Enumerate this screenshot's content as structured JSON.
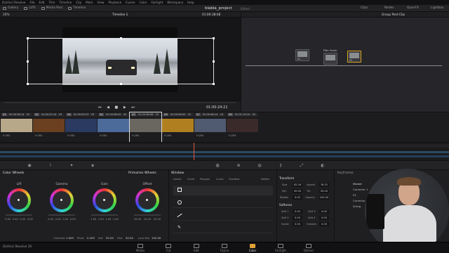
{
  "menubar": {
    "items": [
      "DaVinci Resolve",
      "File",
      "Edit",
      "Trim",
      "Timeline",
      "Clip",
      "Mark",
      "View",
      "Playback",
      "Fusion",
      "Color",
      "Fairlight",
      "Workspace",
      "Help"
    ]
  },
  "toolbar": {
    "left": [
      "Gallery",
      "LUTs",
      "Media Pool",
      "Timeline"
    ],
    "project_title": "blabla_project",
    "project_status": "Edited",
    "right": [
      "Clips",
      "Nodes",
      "OpenFX",
      "Lightbox"
    ]
  },
  "viewer": {
    "zoom": "26%",
    "timeline_name": "Timeline 1",
    "timecode_top": "01:00:38:08",
    "timecode_bottom": "01:00:24:21"
  },
  "nodes": {
    "panel_title": "Group Post-Clip",
    "node1_label": "01",
    "node2_label": "02",
    "film_grain_label": "Film Grain"
  },
  "clips": [
    {
      "num": "01",
      "tc": "01:00:36:14",
      "track": "V2",
      "codec": "H.264",
      "color": "#b7a88a"
    },
    {
      "num": "02",
      "tc": "01:00:22:14",
      "track": "V3",
      "codec": "H.264",
      "color": "#6a4020"
    },
    {
      "num": "03",
      "tc": "01:00:09:22",
      "track": "V3",
      "codec": "H.264",
      "color": "#2a3a60"
    },
    {
      "num": "04",
      "tc": "01:00:08:02",
      "track": "V2",
      "codec": "H.264",
      "color": "#4c6a9a"
    },
    {
      "num": "05",
      "tc": "01:00:38:08",
      "track": "V3",
      "codec": "H.264",
      "color": "#6a6660"
    },
    {
      "num": "06",
      "tc": "01:00:06:02",
      "track": "V2",
      "codec": "H.264",
      "color": "#b08020"
    },
    {
      "num": "07",
      "tc": "01:00:46:14",
      "track": "V3",
      "codec": "H.264",
      "color": "#505a70"
    },
    {
      "num": "08",
      "tc": "01:01:15:10",
      "track": "V2",
      "codec": "H.264",
      "color": "#3a2a2a"
    }
  ],
  "color_wheels": {
    "title": "Color Wheels",
    "mode": "Primaries Wheels",
    "wheels": [
      {
        "name": "Lift",
        "vals": [
          "0.00",
          "0.00",
          "0.00",
          "0.00"
        ]
      },
      {
        "name": "Gamma",
        "vals": [
          "0.00",
          "0.00",
          "0.00",
          "0.00"
        ]
      },
      {
        "name": "Gain",
        "vals": [
          "1.00",
          "1.00",
          "1.00",
          "1.00"
        ]
      },
      {
        "name": "Offset",
        "vals": [
          "25.00",
          "25.00",
          "25.00"
        ]
      }
    ],
    "footer": {
      "contrast_label": "Contrast",
      "contrast_val": "1.000",
      "pivot_label": "Pivot",
      "pivot_val": "0.435",
      "sat_label": "Sat",
      "sat_val": "50.00",
      "hue_label": "Hue",
      "hue_val": "50.00",
      "lum_mix_label": "Lum Mix",
      "lum_mix_val": "100.00"
    }
  },
  "window": {
    "title": "Window",
    "tools": [
      "Linear",
      "Circle",
      "Polygon",
      "Curve",
      "Gradient",
      "Delete"
    ]
  },
  "transform": {
    "title": "Transform",
    "size_label": "Size",
    "size_val": "62.26",
    "aspect_label": "Aspect",
    "aspect_val": "78.31",
    "pan_label": "Pan",
    "pan_val": "50.00",
    "tilt_label": "Tilt",
    "tilt_val": "50.00",
    "rotate_label": "Rotate",
    "rotate_val": "0.00",
    "opacity_label": "Opacity",
    "opacity_val": "100.00",
    "softness_title": "Softness",
    "soft1_label": "Soft 1",
    "soft1_val": "0.00",
    "soft2_label": "Soft 2",
    "soft2_val": "0.00",
    "soft3_label": "Soft 3",
    "soft3_val": "0.00",
    "soft4_label": "Soft 4",
    "soft4_val": "0.00",
    "inside_label": "Inside",
    "inside_val": "0.00",
    "outside_label": "Outside",
    "outside_val": "0.00"
  },
  "keyframes": {
    "title": "Keyframes",
    "timecode": "00:00:36:20",
    "master": "Master",
    "rows": [
      "Corrector 1",
      "FX",
      "Corrector 2",
      "Sizing"
    ]
  },
  "pages": [
    "Media",
    "Cut",
    "Edit",
    "Fusion",
    "Color",
    "Fairlight",
    "Deliver"
  ],
  "app_name": "DaVinci Resolve 16"
}
